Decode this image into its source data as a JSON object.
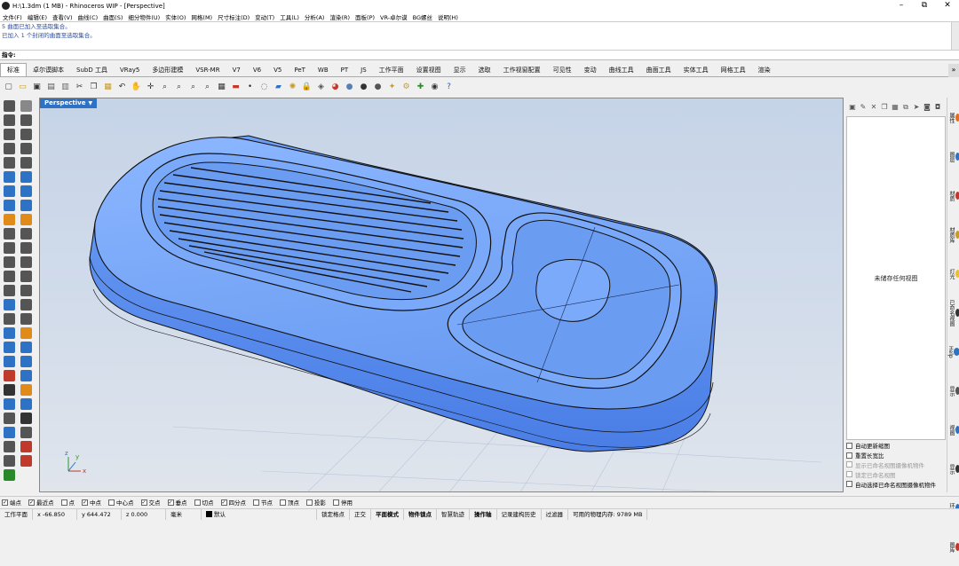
{
  "window": {
    "title": "H:\\1.3dm (1 MB) - Rhinoceros WIP - [Perspective]",
    "minimize": "–",
    "restore": "⧉",
    "close": "✕"
  },
  "menu": [
    "文件(F)",
    "编辑(E)",
    "查看(V)",
    "曲线(C)",
    "曲面(S)",
    "细分物件(U)",
    "实体(O)",
    "网格(M)",
    "尺寸标注(D)",
    "变动(T)",
    "工具(L)",
    "分析(A)",
    "渲染(R)",
    "面板(P)",
    "VR-卓尔谟",
    "BG螺丝",
    "说明(H)"
  ],
  "command_history": [
    "5 曲面已加入至选取集合。",
    "已加入 1 个封闭的曲面至选取集合。"
  ],
  "command_prompt": "指令:",
  "tabs": [
    "标准",
    "卓尔谟脚本",
    "SubD 工具",
    "VRay5",
    "多边形建模",
    "VSR-MR",
    "V7",
    "V6",
    "V5",
    "PeT",
    "WB",
    "PT",
    "JS",
    "工作平面",
    "设置视图",
    "显示",
    "选取",
    "工作视窗配置",
    "可见性",
    "变动",
    "曲线工具",
    "曲面工具",
    "实体工具",
    "网格工具",
    "渲染"
  ],
  "tabs_more": "»",
  "toolbar_icons": [
    {
      "name": "new-file-icon",
      "glyph": "▢",
      "color": "#555"
    },
    {
      "name": "open-file-icon",
      "glyph": "▭",
      "color": "#c89a2a"
    },
    {
      "name": "save-icon",
      "glyph": "▣",
      "color": "#333"
    },
    {
      "name": "print-icon",
      "glyph": "▤",
      "color": "#555"
    },
    {
      "name": "import-icon",
      "glyph": "▥",
      "color": "#666"
    },
    {
      "name": "cut-icon",
      "glyph": "✂",
      "color": "#333"
    },
    {
      "name": "copy-icon",
      "glyph": "❐",
      "color": "#444"
    },
    {
      "name": "paste-icon",
      "glyph": "▦",
      "color": "#c89a2a"
    },
    {
      "name": "undo-icon",
      "glyph": "↶",
      "color": "#333"
    },
    {
      "name": "pan-icon",
      "glyph": "✋",
      "color": "#333"
    },
    {
      "name": "rotate-view-icon",
      "glyph": "✛",
      "color": "#333"
    },
    {
      "name": "zoom-dynamic-icon",
      "glyph": "⌕",
      "color": "#333"
    },
    {
      "name": "zoom-window-icon",
      "glyph": "⌕",
      "color": "#333"
    },
    {
      "name": "zoom-extents-icon",
      "glyph": "⌕",
      "color": "#333"
    },
    {
      "name": "zoom-selected-icon",
      "glyph": "⌕",
      "color": "#333"
    },
    {
      "name": "four-viewports-icon",
      "glyph": "▦",
      "color": "#333"
    },
    {
      "name": "cplane-icon",
      "glyph": "▬",
      "color": "#c0392b"
    },
    {
      "name": "point-icon",
      "glyph": "•",
      "color": "#333"
    },
    {
      "name": "select-icon",
      "glyph": "◌",
      "color": "#555"
    },
    {
      "name": "layer-icon",
      "glyph": "▰",
      "color": "#2e72c6"
    },
    {
      "name": "light-icon",
      "glyph": "✺",
      "color": "#c89a2a"
    },
    {
      "name": "lock-icon",
      "glyph": "🔒",
      "color": "#333"
    },
    {
      "name": "properties-icon",
      "glyph": "◈",
      "color": "#555"
    },
    {
      "name": "render-icon",
      "glyph": "◕",
      "color": "#c0392b"
    },
    {
      "name": "shaded-sphere-icon",
      "glyph": "●",
      "color": "#5a7fb0"
    },
    {
      "name": "rendered-sphere-icon",
      "glyph": "●",
      "color": "#333"
    },
    {
      "name": "material-icon",
      "glyph": "●",
      "color": "#555"
    },
    {
      "name": "analyze-icon",
      "glyph": "✦",
      "color": "#c89a2a"
    },
    {
      "name": "gear-icon",
      "glyph": "⚙",
      "color": "#c89a2a"
    },
    {
      "name": "gumball-icon",
      "glyph": "✚",
      "color": "#2a8a2a"
    },
    {
      "name": "globe-icon",
      "glyph": "◉",
      "color": "#333"
    },
    {
      "name": "help-icon",
      "glyph": "?",
      "color": "#2e5fa8"
    }
  ],
  "left_tools": [
    {
      "name": "select-arrow-icon",
      "color": "#555"
    },
    {
      "name": "point-tool-icon",
      "color": "#888"
    },
    {
      "name": "polyline-icon",
      "color": "#555"
    },
    {
      "name": "curve-icon",
      "color": "#555"
    },
    {
      "name": "circle-icon",
      "color": "#555"
    },
    {
      "name": "arc-icon",
      "color": "#555"
    },
    {
      "name": "rectangle-icon",
      "color": "#555"
    },
    {
      "name": "polygon-icon",
      "color": "#555"
    },
    {
      "name": "ellipse-icon",
      "color": "#555"
    },
    {
      "name": "freeform-icon",
      "color": "#555"
    },
    {
      "name": "surface-icon",
      "color": "#2e72c6"
    },
    {
      "name": "loft-icon",
      "color": "#2e72c6"
    },
    {
      "name": "box-icon",
      "color": "#2e72c6"
    },
    {
      "name": "sphere-icon",
      "color": "#2e72c6"
    },
    {
      "name": "extrude-icon",
      "color": "#2e72c6"
    },
    {
      "name": "revolve-icon",
      "color": "#2e72c6"
    },
    {
      "name": "boolean-icon",
      "color": "#e08a1a"
    },
    {
      "name": "fillet-icon",
      "color": "#e08a1a"
    },
    {
      "name": "trim-icon",
      "color": "#555"
    },
    {
      "name": "split-icon",
      "color": "#555"
    },
    {
      "name": "join-icon",
      "color": "#555"
    },
    {
      "name": "explode-icon",
      "color": "#555"
    },
    {
      "name": "offset-icon",
      "color": "#555"
    },
    {
      "name": "blend-icon",
      "color": "#555"
    },
    {
      "name": "mirror-icon",
      "color": "#555"
    },
    {
      "name": "array-icon",
      "color": "#555"
    },
    {
      "name": "move-icon",
      "color": "#555"
    },
    {
      "name": "scale-icon",
      "color": "#555"
    },
    {
      "name": "project-icon",
      "color": "#2e72c6"
    },
    {
      "name": "dimension-icon",
      "color": "#555"
    },
    {
      "name": "grid-icon",
      "color": "#555"
    },
    {
      "name": "check-icon",
      "color": "#555"
    },
    {
      "name": "analyze-curvature-icon",
      "color": "#2e72c6"
    },
    {
      "name": "draft-icon",
      "color": "#e08a1a"
    },
    {
      "name": "surface-edit-icon",
      "color": "#2e72c6"
    },
    {
      "name": "history-icon",
      "color": "#2e72c6"
    },
    {
      "name": "layer-tool-icon",
      "color": "#2e72c6"
    },
    {
      "name": "pin-icon",
      "color": "#2e72c6"
    },
    {
      "name": "gumball-move-icon",
      "color": "#c0392b"
    },
    {
      "name": "gumball-rotate-icon",
      "color": "#2e72c6"
    },
    {
      "name": "mesh-icon",
      "color": "#333"
    },
    {
      "name": "subd-icon",
      "color": "#e08a1a"
    },
    {
      "name": "globe-tool-icon",
      "color": "#2e72c6"
    },
    {
      "name": "render-tool-icon",
      "color": "#2e72c6"
    },
    {
      "name": "camera-icon",
      "color": "#555"
    },
    {
      "name": "save-tool-icon",
      "color": "#333"
    },
    {
      "name": "dimension-tool-icon",
      "color": "#2e72c6"
    },
    {
      "name": "text-tool-icon",
      "color": "#555"
    },
    {
      "name": "gear-tool-icon",
      "color": "#555"
    },
    {
      "name": "gmail-icon",
      "color": "#c0392b"
    },
    {
      "name": "curve-tool-icon",
      "color": "#555"
    },
    {
      "name": "pen-icon",
      "color": "#c0392b"
    },
    {
      "name": "plugin-icon",
      "color": "#2a8a2a"
    }
  ],
  "viewport": {
    "label": "Perspective",
    "dropdown": "▼",
    "axis_x": "x",
    "axis_y": "y",
    "axis_z": "z"
  },
  "right_panel": {
    "toolbar_icons": [
      "save-icon",
      "edit-icon",
      "delete-icon",
      "copy-icon",
      "paste-icon",
      "duplicate-icon",
      "arrow-icon",
      "camera-icon",
      "view-icon"
    ],
    "empty_text": "未储存任何视图",
    "options": [
      {
        "label": "自动更新缩图",
        "enabled": true
      },
      {
        "label": "重置长宽比",
        "enabled": true
      },
      {
        "label": "显示已命名视图摄像机物件",
        "enabled": false
      },
      {
        "label": "锁定已命名视图",
        "enabled": false
      },
      {
        "label": "自动选择已命名视图摄像机物件",
        "enabled": true
      }
    ]
  },
  "side_tabs": [
    {
      "label": "属性",
      "color": "#e07020"
    },
    {
      "label": "图层",
      "color": "#2e72c6"
    },
    {
      "label": "材质",
      "color": "#c0392b"
    },
    {
      "label": "材质库",
      "color": "#c89a2a"
    },
    {
      "label": "灯光",
      "color": "#e8c030"
    },
    {
      "label": "已命名视图",
      "color": "#333"
    },
    {
      "label": "Help",
      "color": "#2e72c6"
    },
    {
      "label": "显示",
      "color": "#555"
    },
    {
      "label": "视图",
      "color": "#2e72c6"
    },
    {
      "label": "显示",
      "color": "#333"
    },
    {
      "label": "环境",
      "color": "#2e72c6"
    },
    {
      "label": "图库",
      "color": "#c0392b"
    }
  ],
  "osnaps": [
    {
      "label": "端点",
      "checked": true
    },
    {
      "label": "最近点",
      "checked": true
    },
    {
      "label": "点",
      "checked": false
    },
    {
      "label": "中点",
      "checked": true
    },
    {
      "label": "中心点",
      "checked": false
    },
    {
      "label": "交点",
      "checked": true
    },
    {
      "label": "垂点",
      "checked": true
    },
    {
      "label": "切点",
      "checked": false
    },
    {
      "label": "四分点",
      "checked": true
    },
    {
      "label": "节点",
      "checked": false
    },
    {
      "label": "顶点",
      "checked": false
    },
    {
      "label": "投影",
      "checked": false
    },
    {
      "label": "停用",
      "checked": false
    }
  ],
  "status": {
    "cplane": "工作平面",
    "x": "x -66.850",
    "y": "y 644.472",
    "z": "z 0.000",
    "units": "毫米",
    "layer": "默认",
    "grid_snap": "锁定格点",
    "ortho": "正交",
    "planar": "平面模式",
    "osnap": "物件锁点",
    "smarttrack": "智慧轨迹",
    "gumball": "操作轴",
    "history": "记录建构历史",
    "filter": "过滤器",
    "memory": "可用的物理内存: 9789 MB"
  },
  "colors": {
    "viewport_label": "#2e72c6",
    "model_fill": "#6fa0f5",
    "model_dark": "#4a7fe0"
  }
}
